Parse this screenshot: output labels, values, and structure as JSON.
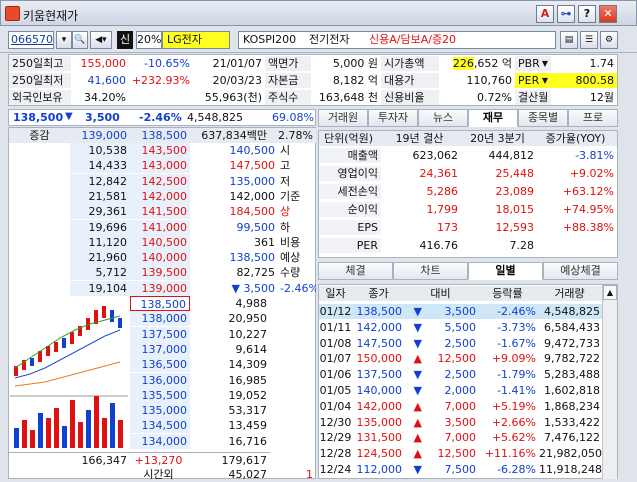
{
  "window": {
    "title": "키움현재가",
    "btn_a": "A",
    "btn_pin": "⊶",
    "btn_help": "?",
    "btn_close": "✕"
  },
  "toolbar": {
    "code": "066570",
    "search": "🔍",
    "dropdown": "▾",
    "speaker": "◀▾",
    "sin": "신",
    "pct": "20%",
    "stock_name": "LG전자",
    "info_index": "KOSPI200",
    "info_sector": "전기전자",
    "info_credit": "신용A/담보A/증20"
  },
  "summary": [
    {
      "l1": "250일최고",
      "v1": "155,000",
      "c1": "-10.65%",
      "d1": "21/01/07",
      "l2": "액면가",
      "v2": "5,000 원",
      "l3": "시가총액",
      "v3a": "226",
      "v3b": ",652 억",
      "l4": "PBR",
      "v4": "1.74"
    },
    {
      "l1": "250일최저",
      "v1": "41,600",
      "c1": "+232.93%",
      "d1": "20/03/23",
      "l2": "자본금",
      "v2": "8,182 억",
      "l3": "대용가",
      "v3a": "",
      "v3b": "110,760",
      "l4": "PER",
      "v4": "800.58"
    },
    {
      "l1": "외국인보유",
      "v1": "34.20%",
      "c1": "",
      "d1": "55,963(천)",
      "l2": "주식수",
      "v2": "163,648 천",
      "l3": "신용비율",
      "v3a": "",
      "v3b": "0.72%",
      "l4": "결산월",
      "v4": "12월"
    }
  ],
  "price": {
    "current": "138,500",
    "arrow": "▼",
    "change": "3,500",
    "rate": "-2.46%",
    "volume": "4,548,825",
    "vol_ratio": "69.08%"
  },
  "ob_header": {
    "label": "증감",
    "sell_total": "139,000",
    "price": "138,500",
    "amount": "637,834백만",
    "pct": "2.78%"
  },
  "asks": [
    {
      "vol": "10,538",
      "price": "143,500",
      "info": "140,500",
      "tag": "시"
    },
    {
      "vol": "14,433",
      "price": "143,000",
      "info": "147,500",
      "tag": "고"
    },
    {
      "vol": "12,842",
      "price": "142,500",
      "info": "135,000",
      "tag": "저"
    },
    {
      "vol": "21,581",
      "price": "142,000",
      "info": "142,000",
      "tag": "기준"
    },
    {
      "vol": "29,361",
      "price": "141,500",
      "info": "184,500",
      "tag": "상"
    },
    {
      "vol": "19,696",
      "price": "141,000",
      "info": "99,500",
      "tag": "하"
    },
    {
      "vol": "11,120",
      "price": "140,500",
      "info": "361",
      "tag": "비용"
    },
    {
      "vol": "21,960",
      "price": "140,000",
      "info": "138,500",
      "tag": "예상"
    },
    {
      "vol": "5,712",
      "price": "139,500",
      "info": "82,725",
      "tag": "수량"
    },
    {
      "vol": "19,104",
      "price": "139,000",
      "info": "▼ 3,500",
      "tag": "-2.46%"
    }
  ],
  "bids": [
    {
      "price": "138,500",
      "vol": "4,988"
    },
    {
      "price": "138,000",
      "vol": "20,950"
    },
    {
      "price": "137,500",
      "vol": "10,227"
    },
    {
      "price": "137,000",
      "vol": "9,614"
    },
    {
      "price": "136,500",
      "vol": "14,309"
    },
    {
      "price": "136,000",
      "vol": "16,985"
    },
    {
      "price": "135,500",
      "vol": "19,052"
    },
    {
      "price": "135,000",
      "vol": "53,317"
    },
    {
      "price": "134,500",
      "vol": "13,459"
    },
    {
      "price": "134,000",
      "vol": "16,716"
    }
  ],
  "ob_footer": {
    "ask_total": "166,347",
    "diff": "+13,270",
    "bid_total": "179,617",
    "after_label": "시간외",
    "after_vol": "45,027",
    "after_cnt": "1"
  },
  "tabs1": [
    "거래원",
    "투자자",
    "뉴스",
    "재무",
    "종목별",
    "프로"
  ],
  "fin": {
    "headers": [
      "단위(억원)",
      "19년 결산",
      "20년 3분기",
      "증가율(YOY)"
    ],
    "rows": [
      {
        "label": "매출액",
        "a": "623,062",
        "b": "444,812",
        "c": "-3.81%"
      },
      {
        "label": "영업이익",
        "a": "24,361",
        "b": "25,448",
        "c": "+9.02%"
      },
      {
        "label": "세전손익",
        "a": "5,286",
        "b": "23,089",
        "c": "+63.12%"
      },
      {
        "label": "순이익",
        "a": "1,799",
        "b": "18,015",
        "c": "+74.95%"
      },
      {
        "label": "EPS",
        "a": "173",
        "b": "12,593",
        "c": "+88.38%"
      },
      {
        "label": "PER",
        "a": "416.76",
        "b": "7.28",
        "c": ""
      }
    ]
  },
  "tabs2": [
    "체결",
    "차트",
    "일별",
    "예상체결"
  ],
  "daily": {
    "headers": [
      "일자",
      "종가",
      "대비",
      "등락률",
      "거래량"
    ],
    "rows": [
      {
        "d": "01/12",
        "p": "138,500",
        "s": "▼",
        "c": "3,500",
        "r": "-2.46%",
        "v": "4,548,825",
        "dir": "dn"
      },
      {
        "d": "01/11",
        "p": "142,000",
        "s": "▼",
        "c": "5,500",
        "r": "-3.73%",
        "v": "6,584,433",
        "dir": "dn"
      },
      {
        "d": "01/08",
        "p": "147,500",
        "s": "▼",
        "c": "2,500",
        "r": "-1.67%",
        "v": "9,472,733",
        "dir": "dn"
      },
      {
        "d": "01/07",
        "p": "150,000",
        "s": "▲",
        "c": "12,500",
        "r": "+9.09%",
        "v": "9,782,722",
        "dir": "up"
      },
      {
        "d": "01/06",
        "p": "137,500",
        "s": "▼",
        "c": "2,500",
        "r": "-1.79%",
        "v": "5,283,488",
        "dir": "dn"
      },
      {
        "d": "01/05",
        "p": "140,000",
        "s": "▼",
        "c": "2,000",
        "r": "-1.41%",
        "v": "1,602,818",
        "dir": "dn"
      },
      {
        "d": "01/04",
        "p": "142,000",
        "s": "▲",
        "c": "7,000",
        "r": "+5.19%",
        "v": "1,868,234",
        "dir": "up"
      },
      {
        "d": "12/30",
        "p": "135,000",
        "s": "▲",
        "c": "3,500",
        "r": "+2.66%",
        "v": "1,533,422",
        "dir": "up"
      },
      {
        "d": "12/29",
        "p": "131,500",
        "s": "▲",
        "c": "7,000",
        "r": "+5.62%",
        "v": "7,476,122",
        "dir": "up"
      },
      {
        "d": "12/28",
        "p": "124,500",
        "s": "▲",
        "c": "12,500",
        "r": "+11.16%",
        "v": "21,982,050",
        "dir": "up"
      },
      {
        "d": "12/24",
        "p": "112,000",
        "s": "▼",
        "c": "7,500",
        "r": "-6.28%",
        "v": "11,918,248",
        "dir": "dn"
      }
    ]
  },
  "colors": {
    "up": "#e01010",
    "down": "#1040d0",
    "highlight": "#ffff20"
  }
}
